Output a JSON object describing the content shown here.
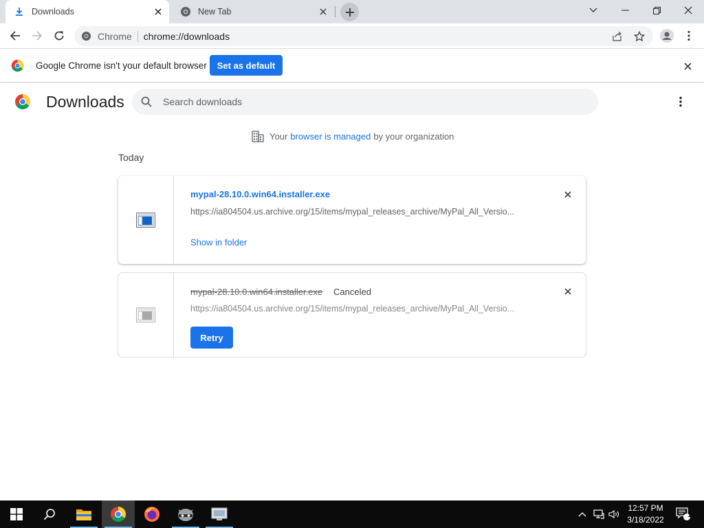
{
  "window": {
    "tabs": [
      {
        "label": "Downloads",
        "icon": "download-icon",
        "active": true
      },
      {
        "label": "New Tab",
        "icon": "chrome-icon",
        "active": false
      }
    ],
    "controls": [
      "chevron-down-icon",
      "minimize-icon",
      "restore-icon",
      "close-icon"
    ]
  },
  "toolbar": {
    "scheme_label": "Chrome",
    "url": "chrome://downloads"
  },
  "infobar": {
    "message": "Google Chrome isn't your default browser",
    "button_label": "Set as default"
  },
  "page": {
    "title": "Downloads",
    "search_placeholder": "Search downloads",
    "managed": {
      "prefix": "Your",
      "link": "browser is managed",
      "suffix": "by your organization"
    },
    "section_label": "Today",
    "downloads": [
      {
        "filename": "mypal-28.10.0.win64.installer.exe",
        "url": "https://ia804504.us.archive.org/15/items/mypal_releases_archive/MyPal_All_Versio...",
        "action_label": "Show in folder",
        "status": ""
      },
      {
        "filename": "mypal-28.10.0.win64.installer.exe",
        "url": "https://ia804504.us.archive.org/15/items/mypal_releases_archive/MyPal_All_Versio...",
        "action_label": "Retry",
        "status": "Canceled"
      }
    ]
  },
  "taskbar": {
    "apps": [
      "windows-start-icon",
      "search-icon",
      "file-explorer-icon",
      "chrome-icon",
      "firefox-icon",
      "raccoon-app-icon",
      "monitor-app-icon"
    ],
    "time": "12:57 PM",
    "date": "3/18/2022",
    "notification_count": "1"
  },
  "colors": {
    "accent": "#1a73e8",
    "tabstrip": "#dee1e6",
    "taskbar": "#0b0b0b"
  }
}
